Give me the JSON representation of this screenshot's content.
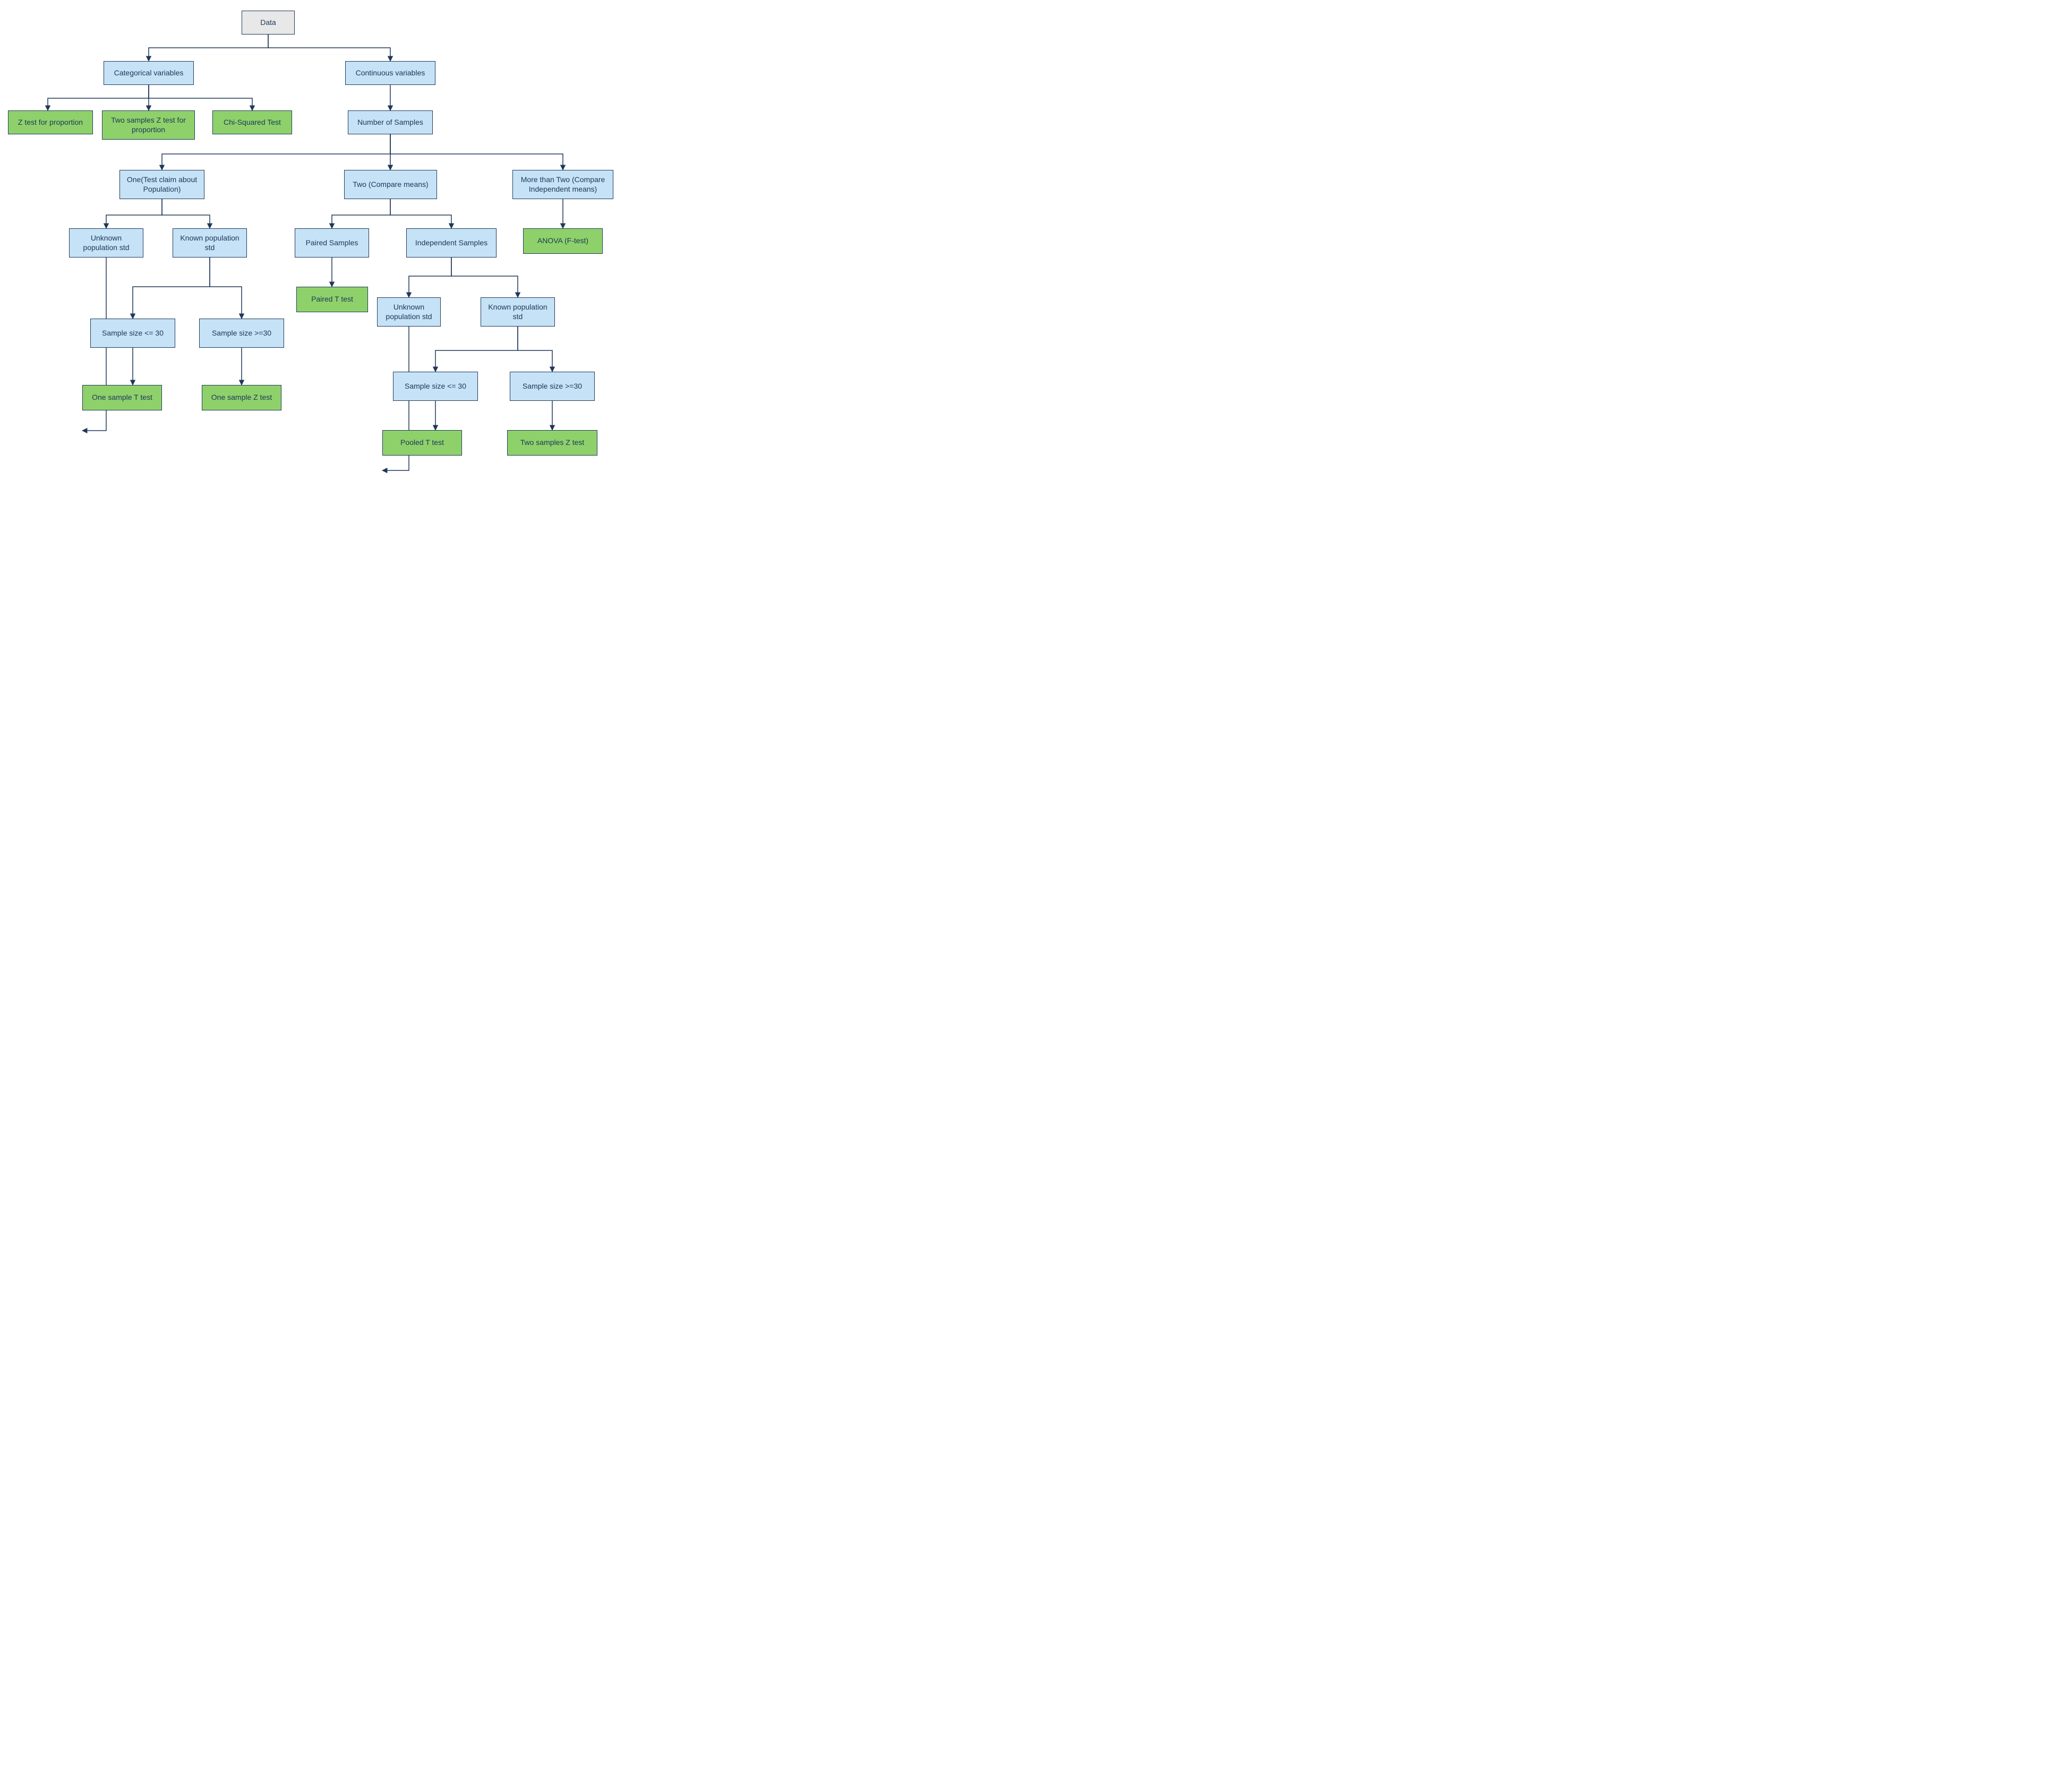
{
  "root": {
    "label": "Data"
  },
  "categorical": {
    "label": "Categorical variables"
  },
  "continuous": {
    "label": "Continuous variables"
  },
  "z_prop": {
    "label": "Z test for proportion"
  },
  "z_prop2": {
    "label": "Two samples Z test for proportion"
  },
  "chi2": {
    "label": "Chi-Squared Test"
  },
  "num_samples": {
    "label": "Number of Samples"
  },
  "one_pop": {
    "label": "One(Test claim about Population)"
  },
  "two_means": {
    "label": "Two (Compare means)"
  },
  "more_two": {
    "label": "More than Two (Compare Independent means)"
  },
  "unknown_std1": {
    "label": "Unknown population std"
  },
  "known_std1": {
    "label": "Known population std"
  },
  "paired": {
    "label": "Paired Samples"
  },
  "indep": {
    "label": "Independent Samples"
  },
  "anova": {
    "label": "ANOVA (F-test)"
  },
  "paired_t": {
    "label": "Paired T test"
  },
  "unknown_std2": {
    "label": "Unknown population std"
  },
  "known_std2": {
    "label": "Known population std"
  },
  "ss_le30_a": {
    "label": "Sample size <= 30"
  },
  "ss_ge30_a": {
    "label": "Sample size >=30"
  },
  "one_t": {
    "label": "One sample T test"
  },
  "one_z": {
    "label": "One sample Z test"
  },
  "ss_le30_b": {
    "label": "Sample size <= 30"
  },
  "ss_ge30_b": {
    "label": "Sample size >=30"
  },
  "pooled_t": {
    "label": "Pooled T test"
  },
  "two_z": {
    "label": "Two samples Z test"
  }
}
